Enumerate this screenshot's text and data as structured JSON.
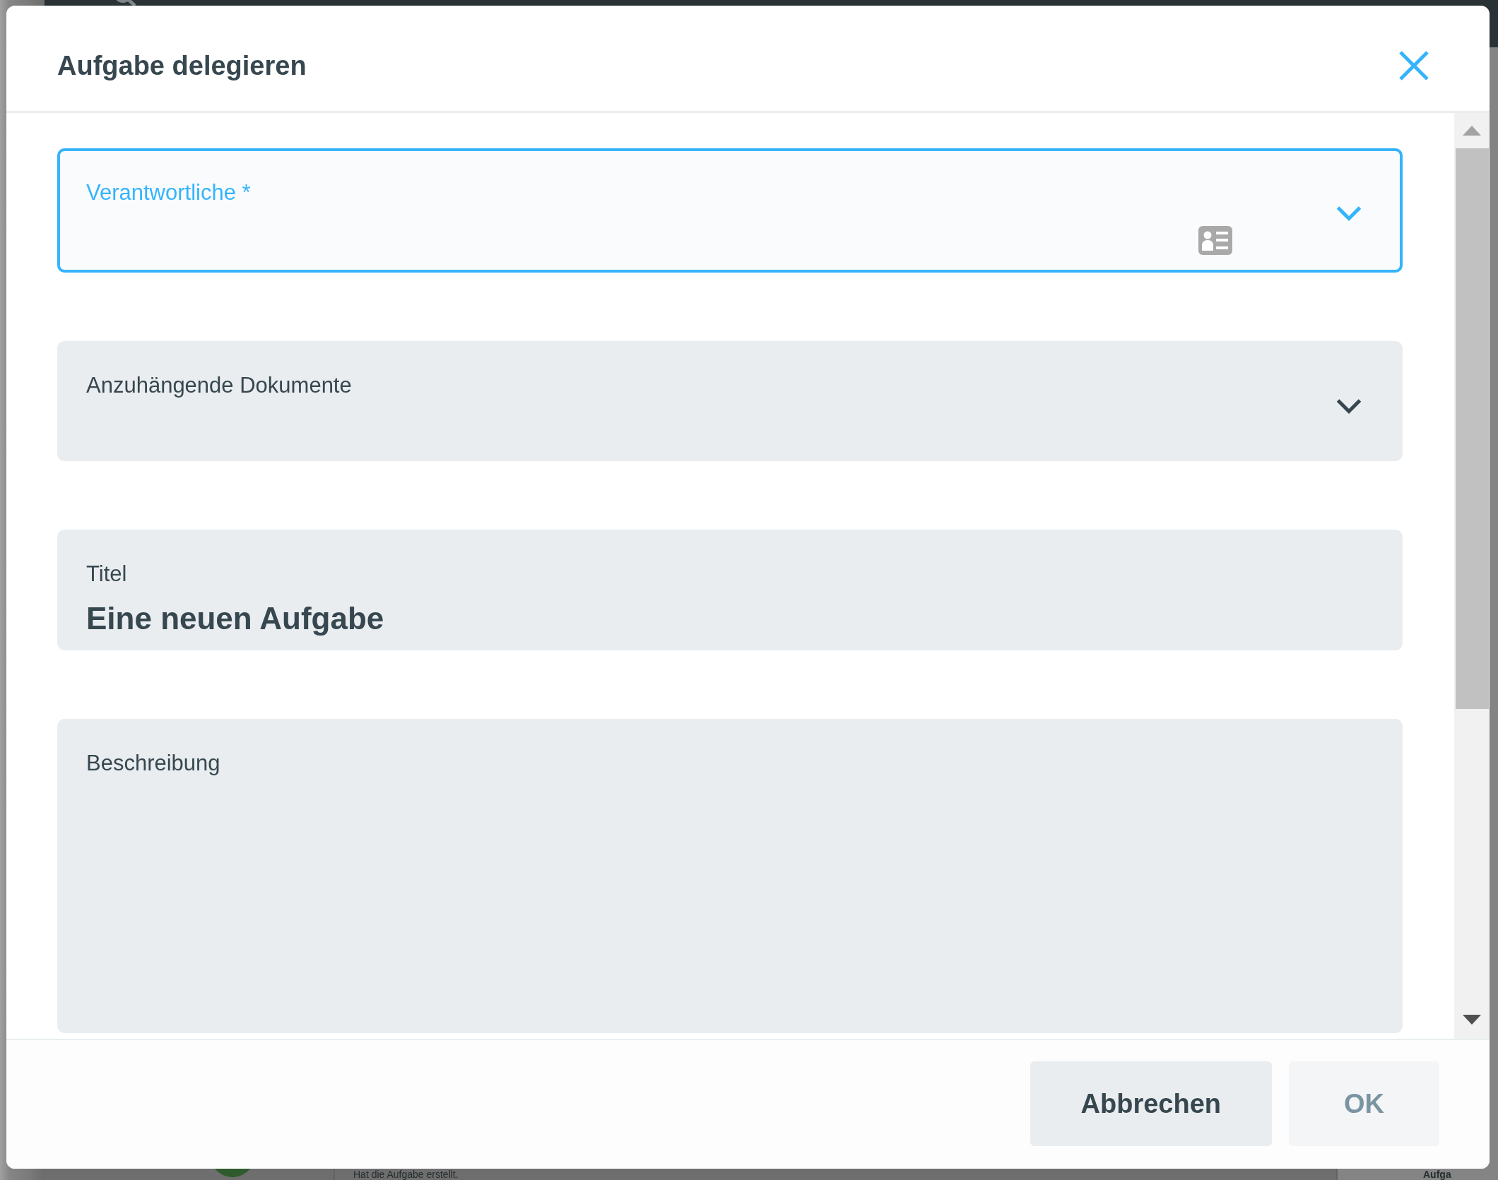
{
  "backdrop": {
    "activity_text": "Hat die Aufgabe erstellt.",
    "right_panel_text": "Aufga"
  },
  "dialog": {
    "title": "Aufgabe delegieren",
    "fields": [
      {
        "kind": "person-select",
        "label": "Verantwortliche *",
        "focused": true
      },
      {
        "kind": "select",
        "label": "Anzuhängende Dokumente",
        "focused": false
      },
      {
        "kind": "text",
        "label": "Titel",
        "value": "Eine neuen Aufgabe",
        "focused": false
      },
      {
        "kind": "textarea",
        "label": "Beschreibung",
        "focused": false
      }
    ],
    "buttons": [
      {
        "label": "Abbrechen",
        "disabled": false
      },
      {
        "label": "OK",
        "disabled": true
      }
    ]
  }
}
